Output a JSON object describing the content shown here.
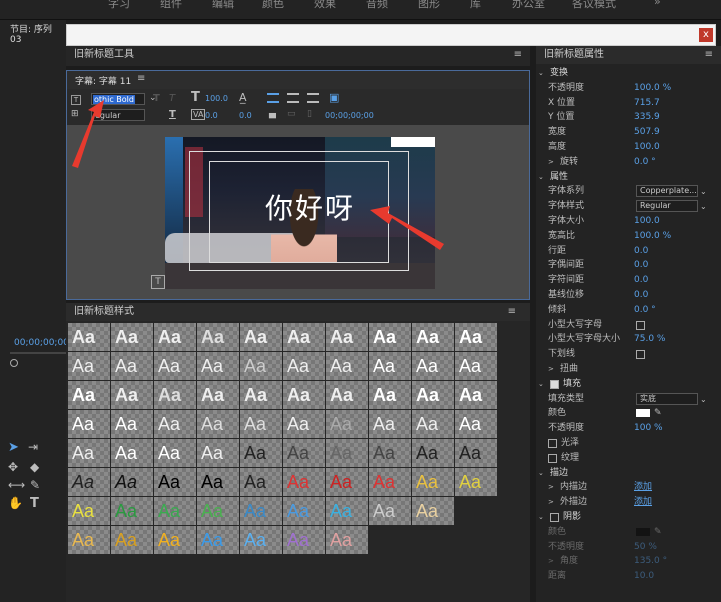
{
  "menu": {
    "items": [
      "字习",
      "组件",
      "编辑",
      "颜色",
      "效果",
      "音频",
      "图形",
      "库",
      "办公室",
      "各议模式",
      "»"
    ]
  },
  "left": {
    "program_label": "节目: 序列 03",
    "timecode": "00;00;00;00"
  },
  "dialog": {
    "close": "x"
  },
  "editor": {
    "panel_title": "旧新标题工具",
    "tab_title": "字幕: 字幕 11",
    "font_family": "othic Bold",
    "font_style": "egular",
    "font_size": "100.0",
    "leading": "0.0",
    "kerning": "0.0",
    "tab_stop": "0.0",
    "timecode": "00;00;00;00",
    "title_text": "你好呀"
  },
  "styles": {
    "panel_title": "旧新标题样式",
    "swatch_label": "Aa"
  },
  "props": {
    "panel_title": "旧新标题属性",
    "rows": [
      {
        "label": "变换",
        "type": "section"
      },
      {
        "label": "不透明度",
        "value": "100.0 %"
      },
      {
        "label": "X 位置",
        "value": "715.7"
      },
      {
        "label": "Y 位置",
        "value": "335.9"
      },
      {
        "label": "宽度",
        "value": "507.9"
      },
      {
        "label": "高度",
        "value": "100.0"
      },
      {
        "label": "旋转",
        "value": "0.0 °",
        "indent": true
      },
      {
        "label": "属性",
        "type": "section"
      },
      {
        "label": "字体系列",
        "dropdown": "Copperplate..."
      },
      {
        "label": "字体样式",
        "dropdown": "Regular"
      },
      {
        "label": "字体大小",
        "value": "100.0"
      },
      {
        "label": "宽高比",
        "value": "100.0 %"
      },
      {
        "label": "行距",
        "value": "0.0"
      },
      {
        "label": "字偶间距",
        "value": "0.0"
      },
      {
        "label": "字符间距",
        "value": "0.0"
      },
      {
        "label": "基线位移",
        "value": "0.0"
      },
      {
        "label": "倾斜",
        "value": "0.0 °"
      },
      {
        "label": "小型大写字母",
        "checkbox": true
      },
      {
        "label": "小型大写字母大小",
        "value": "75.0 %"
      },
      {
        "label": "下划线",
        "checkbox": true
      },
      {
        "label": "扭曲",
        "indent": true
      },
      {
        "label": "填充",
        "type": "section",
        "checked": true
      },
      {
        "label": "填充类型",
        "dropdown": "实底"
      },
      {
        "label": "颜色",
        "swatch": true
      },
      {
        "label": "不透明度",
        "value": "100 %"
      },
      {
        "label": "光泽",
        "checkbox_left": true
      },
      {
        "label": "纹理",
        "checkbox_left": true
      },
      {
        "label": "描边",
        "type": "section"
      },
      {
        "label": "内描边",
        "link": "添加",
        "indent": true
      },
      {
        "label": "外描边",
        "link": "添加",
        "indent": true
      },
      {
        "label": "阴影",
        "type": "section",
        "checkbox_left": true
      },
      {
        "label": "颜色",
        "swatch_dark": true,
        "dim": true
      },
      {
        "label": "不透明度",
        "value": "50 %",
        "dim": true
      },
      {
        "label": "角度",
        "value": "135.0 °",
        "dim": true,
        "indent": true
      },
      {
        "label": "距离",
        "value": "10.0",
        "dim": true
      }
    ]
  }
}
